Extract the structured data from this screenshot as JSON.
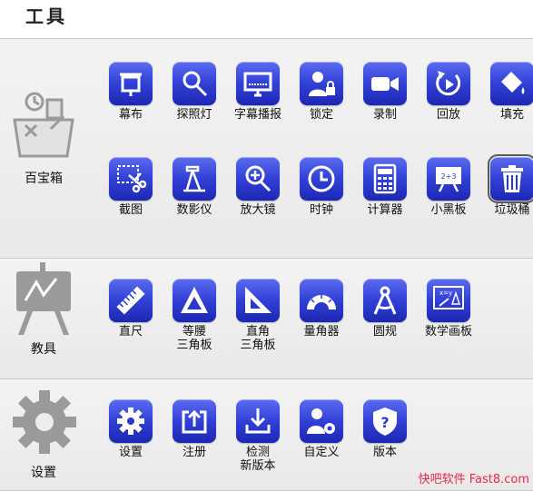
{
  "header": {
    "title": "工具"
  },
  "sections": {
    "toolbox": {
      "label": "百宝箱",
      "items": [
        "幕布",
        "探照灯",
        "字幕播报",
        "锁定",
        "录制",
        "回放",
        "填充",
        "截图",
        "数影仪",
        "放大镜",
        "时钟",
        "计算器",
        "小黑板",
        "垃圾桶"
      ]
    },
    "teaching": {
      "label": "教具",
      "items": [
        "直尺",
        "等腰\n三角板",
        "直角\n三角板",
        "量角器",
        "圆规",
        "数学画板"
      ]
    },
    "settings": {
      "label": "设置",
      "items": [
        "设置",
        "注册",
        "检测\n新版本",
        "自定义",
        "版本"
      ]
    }
  },
  "watermark": "快吧软件 Fast8.com"
}
